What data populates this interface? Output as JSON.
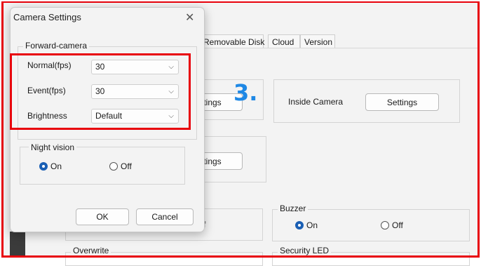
{
  "tabs": [
    "Removable Disk",
    "Cloud",
    "Version"
  ],
  "background": {
    "settings_btn_1": "ttings",
    "settings_btn_2": "ttings",
    "inside_camera_label": "Inside Camera",
    "inside_camera_settings": "Settings",
    "buzzer_legend": "Buzzer",
    "buzzer_on": "On",
    "buzzer_off": "Off",
    "overwrite_legend": "Overwrite",
    "security_led_legend": "Security LED",
    "partial_f": "f"
  },
  "annotation": {
    "step": "3."
  },
  "dialog": {
    "title": "Camera Settings",
    "close_icon": "close-icon",
    "group_label": "Forward-camera",
    "normal_label": "Normal(fps)",
    "normal_value": "30",
    "event_label": "Event(fps)",
    "event_value": "30",
    "brightness_label": "Brightness",
    "brightness_value": "Default",
    "night_vision_legend": "Night vision",
    "night_on": "On",
    "night_off": "Off",
    "ok": "OK",
    "cancel": "Cancel"
  },
  "colors": {
    "highlight": "#e8000b",
    "accent": "#1e88e5",
    "radio_selected": "#1a5fb4"
  }
}
